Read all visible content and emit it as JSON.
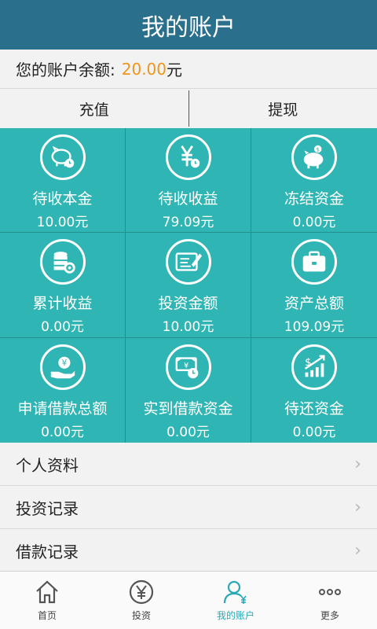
{
  "header": {
    "title": "我的账户"
  },
  "balance": {
    "label": "您的账户余额:",
    "amount": "20.00",
    "unit": "元"
  },
  "actions": {
    "recharge": "充值",
    "withdraw": "提现"
  },
  "tiles": [
    {
      "icon": "piggy-clock-icon",
      "label": "待收本金",
      "value": "10.00元"
    },
    {
      "icon": "yen-clock-icon",
      "label": "待收收益",
      "value": "79.09元"
    },
    {
      "icon": "piggy-coin-icon",
      "label": "冻结资金",
      "value": "0.00元"
    },
    {
      "icon": "coins-gear-icon",
      "label": "累计收益",
      "value": "0.00元"
    },
    {
      "icon": "document-pen-icon",
      "label": "投资金额",
      "value": "10.00元"
    },
    {
      "icon": "briefcase-icon",
      "label": "资产总额",
      "value": "109.09元"
    },
    {
      "icon": "hand-yen-icon",
      "label": "申请借款总额",
      "value": "0.00元"
    },
    {
      "icon": "money-clock-icon",
      "label": "实到借款资金",
      "value": "0.00元"
    },
    {
      "icon": "dollar-chart-icon",
      "label": "待还资金",
      "value": "0.00元"
    }
  ],
  "menu": [
    {
      "label": "个人资料"
    },
    {
      "label": "投资记录"
    },
    {
      "label": "借款记录"
    }
  ],
  "tabs": [
    {
      "label": "首页",
      "icon": "home-icon"
    },
    {
      "label": "投资",
      "icon": "yen-circle-icon"
    },
    {
      "label": "我的账户",
      "icon": "user-yen-icon"
    },
    {
      "label": "更多",
      "icon": "more-dots-icon"
    }
  ],
  "colors": {
    "header": "#2a6f8b",
    "tile": "#2fb5b3",
    "amount": "#f0941c",
    "active_tab": "#2aa9b5"
  }
}
